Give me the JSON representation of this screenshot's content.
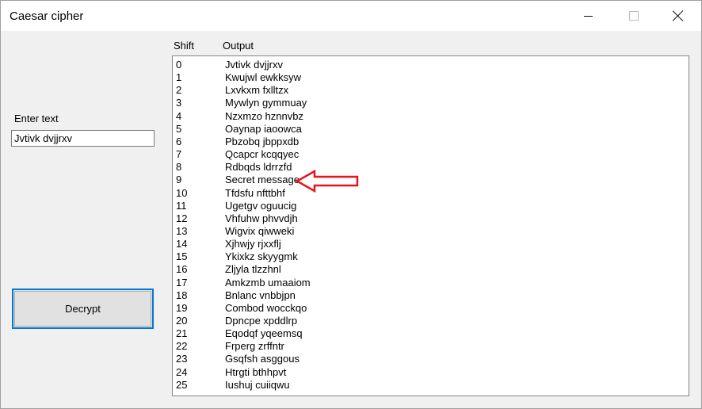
{
  "window": {
    "title": "Caesar cipher"
  },
  "input": {
    "label": "Enter text",
    "value": "Jvtivk dvjjrxv"
  },
  "decrypt_button": {
    "label": "Decrypt"
  },
  "results": {
    "shift_header": "Shift",
    "output_header": "Output",
    "rows": [
      {
        "shift": "0",
        "output": "Jvtivk dvjjrxv"
      },
      {
        "shift": "1",
        "output": "Kwujwl ewkksyw"
      },
      {
        "shift": "2",
        "output": "Lxvkxm fxlltzx"
      },
      {
        "shift": "3",
        "output": "Mywlyn gymmuay"
      },
      {
        "shift": "4",
        "output": "Nzxmzo hznnvbz"
      },
      {
        "shift": "5",
        "output": "Oaynap iaoowca"
      },
      {
        "shift": "6",
        "output": "Pbzobq jbppxdb"
      },
      {
        "shift": "7",
        "output": "Qcapcr kcqqyec"
      },
      {
        "shift": "8",
        "output": "Rdbqds ldrrzfd"
      },
      {
        "shift": "9",
        "output": "Secret message"
      },
      {
        "shift": "10",
        "output": "Tfdsfu nfttbhf"
      },
      {
        "shift": "11",
        "output": "Ugetgv oguucig"
      },
      {
        "shift": "12",
        "output": "Vhfuhw phvvdjh"
      },
      {
        "shift": "13",
        "output": "Wigvix qiwweki"
      },
      {
        "shift": "14",
        "output": "Xjhwjy rjxxflj"
      },
      {
        "shift": "15",
        "output": "Ykixkz skyygmk"
      },
      {
        "shift": "16",
        "output": "Zljyla tlzzhnl"
      },
      {
        "shift": "17",
        "output": "Amkzmb umaaiom"
      },
      {
        "shift": "18",
        "output": "Bnlanc vnbbjpn"
      },
      {
        "shift": "19",
        "output": "Combod wocckqo"
      },
      {
        "shift": "20",
        "output": "Dpncpe xpddlrp"
      },
      {
        "shift": "21",
        "output": "Eqodqf yqeemsq"
      },
      {
        "shift": "22",
        "output": "Frperg zrffntr"
      },
      {
        "shift": "23",
        "output": "Gsqfsh asggous"
      },
      {
        "shift": "24",
        "output": "Htrgti bthhpvt"
      },
      {
        "shift": "25",
        "output": "Iushuj cuiiqwu"
      }
    ]
  },
  "annotation": {
    "icon": "left-arrow-icon",
    "highlighted_shift": "9",
    "color": "#e8141b"
  }
}
